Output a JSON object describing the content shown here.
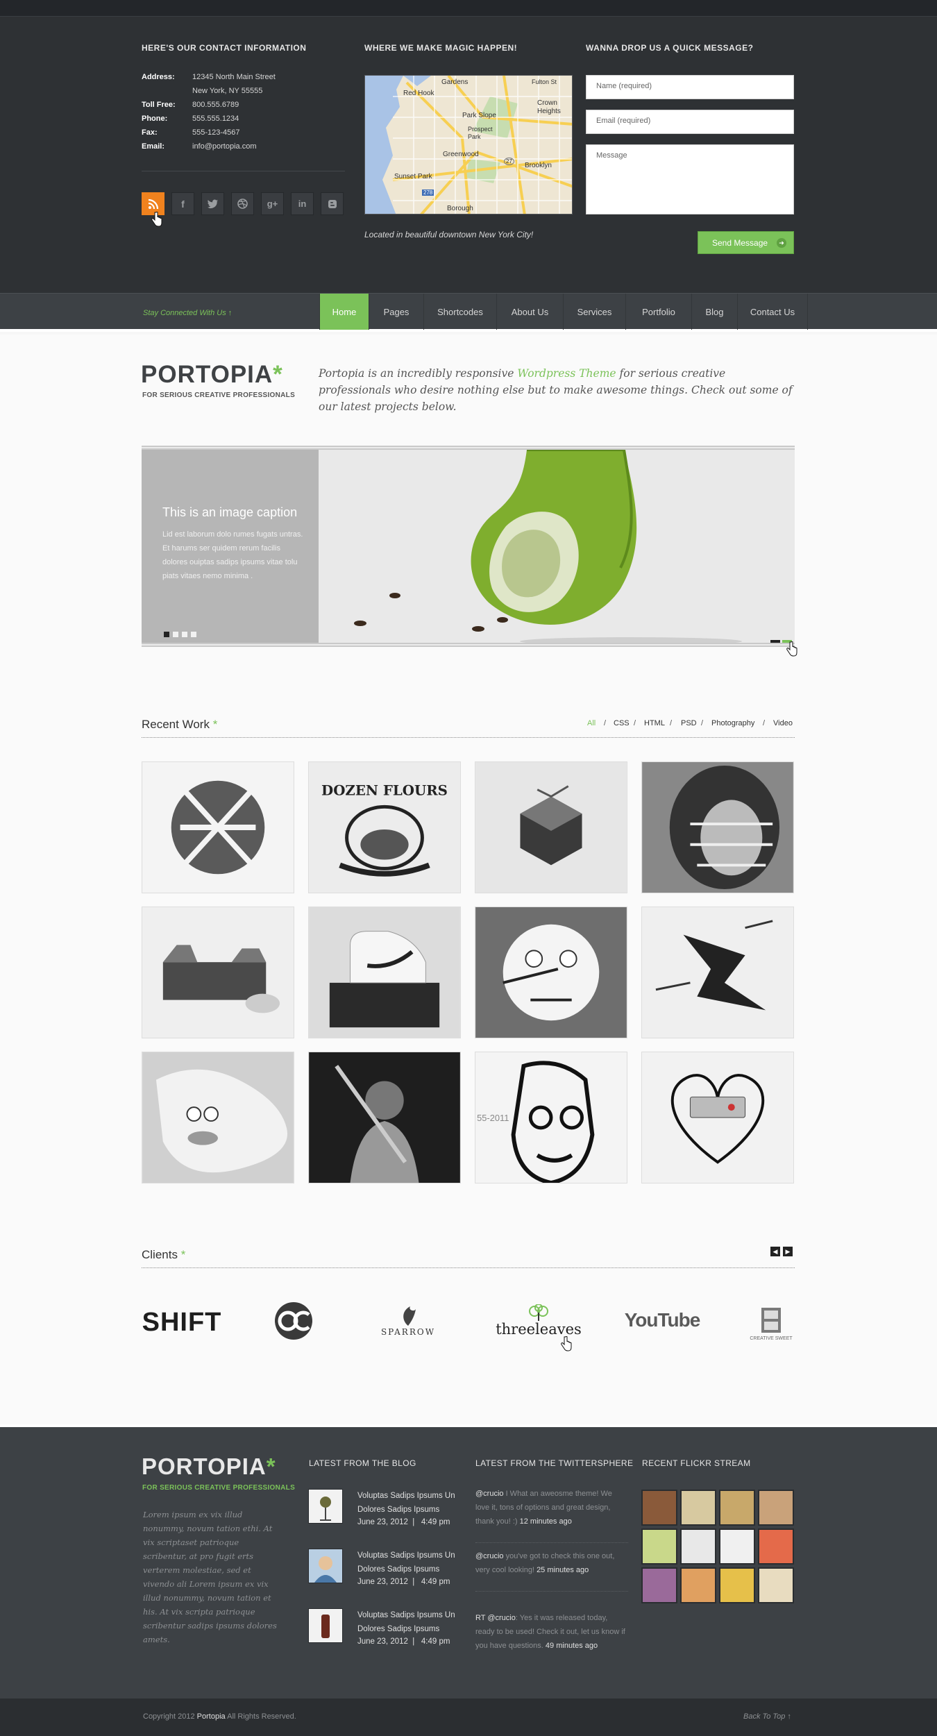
{
  "contact": {
    "heading": "HERE'S OUR CONTACT INFORMATION",
    "rows": [
      {
        "key": "Address:",
        "value": "12345 North Main Street"
      },
      {
        "key": "",
        "value": "New York, NY 55555"
      },
      {
        "key": "Toll Free:",
        "value": "800.555.6789"
      },
      {
        "key": "Phone:",
        "value": "555.555.1234"
      },
      {
        "key": "Fax:",
        "value": "555-123-4567"
      },
      {
        "key": "Email:",
        "value": "info@portopia.com"
      }
    ],
    "social_icons": [
      "rss-icon",
      "facebook-icon",
      "twitter-icon",
      "dribbble-icon",
      "google-plus-icon",
      "linkedin-icon",
      "blogger-icon"
    ]
  },
  "map": {
    "heading": "WHERE WE MAKE MAGIC HAPPEN!",
    "caption": "Located in beautiful downtown New York City!",
    "labels": [
      "Gardens",
      "Fulton St",
      "Red Hook",
      "Crown Heights",
      "Park Slope",
      "Prospect Park",
      "Greenwood",
      "Brooklyn",
      "Sunset Park",
      "Borough",
      "278",
      "27"
    ]
  },
  "message": {
    "heading": "WANNA DROP US A QUICK MESSAGE?",
    "name_placeholder": "Name (required)",
    "email_placeholder": "Email (required)",
    "message_placeholder": "Message",
    "send_label": "Send Message"
  },
  "nav": {
    "stay_connected": "Stay Connected With Us",
    "items": [
      "Home",
      "Pages",
      "Shortcodes",
      "About Us",
      "Services",
      "Portfolio",
      "Blog",
      "Contact Us"
    ],
    "active": "Home"
  },
  "brand": {
    "name": "PORTOPIA",
    "tagline": "FOR SERIOUS CREATIVE PROFESSIONALS"
  },
  "intro": {
    "before": "Portopia is an incredibly responsive ",
    "highlight": "Wordpress Theme",
    "after": " for serious creative professionals who desire nothing else but to make awesome things. Check out some of our latest projects below."
  },
  "slider": {
    "caption_title": "This is an image caption",
    "caption_body": "Lid est laborum dolo rumes fugats untras. Et harums ser quidem rerum facilis dolores ouiptas sadips ipsums vitae tolu piats vitaes nemo minima ."
  },
  "recent_work": {
    "title": "Recent Work",
    "filters": [
      "All",
      "CSS",
      "HTML",
      "PSD",
      "Photography",
      "Video"
    ],
    "active_filter": "All",
    "thumb_texts": [
      "DOZEN FLOURS",
      "55-2011"
    ]
  },
  "clients": {
    "title": "Clients",
    "logos": [
      "SHIFT",
      "OC",
      "SPARROW",
      "threeleaves",
      "YouTube",
      "CREATIVE SWEET"
    ]
  },
  "footer": {
    "brand": "PORTOPIA",
    "tagline": "FOR SERIOUS CREATIVE PROFESSIONALS",
    "about": "Lorem ipsum ex vix illud nonummy, novum tation ethi. At vix scriptaset patrioque scribentur, at pro fugit erts verterem molestiae, sed et vivendo ali Lorem ipsum ex vix illud nonummy, novum tation et his. At vix scripta patrioque scribentur sadips ipsums dolores amets.",
    "blog_heading": "LATEST FROM THE BLOG",
    "posts": [
      {
        "title": "Voluptas Sadips Ipsums Un Dolores Sadips Ipsums",
        "date": "June 23, 2012",
        "time": "4:49 pm"
      },
      {
        "title": "Voluptas Sadips Ipsums Un Dolores Sadips Ipsums",
        "date": "June 23, 2012",
        "time": "4:49 pm"
      },
      {
        "title": "Voluptas Sadips Ipsums Un Dolores Sadips Ipsums",
        "date": "June 23, 2012",
        "time": "4:49 pm"
      }
    ],
    "twitter_heading": "LATEST FROM THE TWITTERSPHERE",
    "tweets": [
      {
        "user": "@crucio",
        "text": " I What an aweosme theme!  We love it, tons of options and great design, thank you!  :)",
        "time": "12 minutes ago"
      },
      {
        "user": "@crucio",
        "text": " you've got to check this one out, very cool looking!",
        "time": "25 minutes ago"
      },
      {
        "user": "RT @crucio",
        "text": ": Yes it was released today, ready to be used! Check it out, let us know if you have questions.",
        "time": "49 minutes ago"
      }
    ],
    "flickr_heading": "RECENT FLICKR STREAM",
    "copyright_before": "Copyright 2012 ",
    "copyright_brand": "Portopia",
    "copyright_after": "  All Rights Reserved.",
    "back_to_top": "Back To Top"
  },
  "colors": {
    "accent": "#7bc259",
    "dark": "#2e3134",
    "rss": "#f0821e"
  }
}
